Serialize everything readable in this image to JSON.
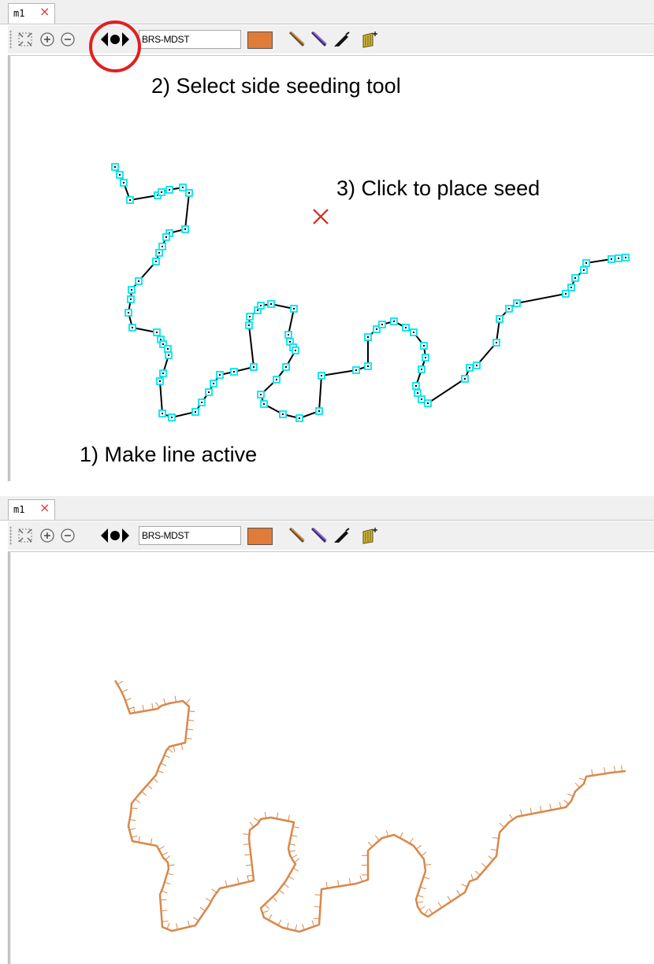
{
  "panels": [
    {
      "tab": {
        "label": "m1",
        "close_glyph": "×"
      },
      "toolbar": {
        "layer_name": "BRS-MDST",
        "swatch_color": "#e07b39"
      },
      "annotations": {
        "step2": "2) Select side seeding tool",
        "step3": "3) Click to place seed",
        "step1": "1) Make line active"
      }
    },
    {
      "tab": {
        "label": "m1",
        "close_glyph": "×"
      },
      "toolbar": {
        "layer_name": "BRS-MDST",
        "swatch_color": "#e07b39"
      }
    }
  ],
  "icons": [
    "zoom-extents-icon",
    "zoom-in-icon",
    "zoom-out-icon",
    "side-seeding-icon",
    "pen-brown-icon",
    "pen-purple-icon",
    "knife-icon",
    "add-layer-icon"
  ],
  "colors": {
    "active_line": "#000000",
    "vertex_marker": "#00e5ee",
    "seed_marker": "#e02020",
    "highlight_circle": "#e02020",
    "seeded_line": "#d9884a"
  }
}
